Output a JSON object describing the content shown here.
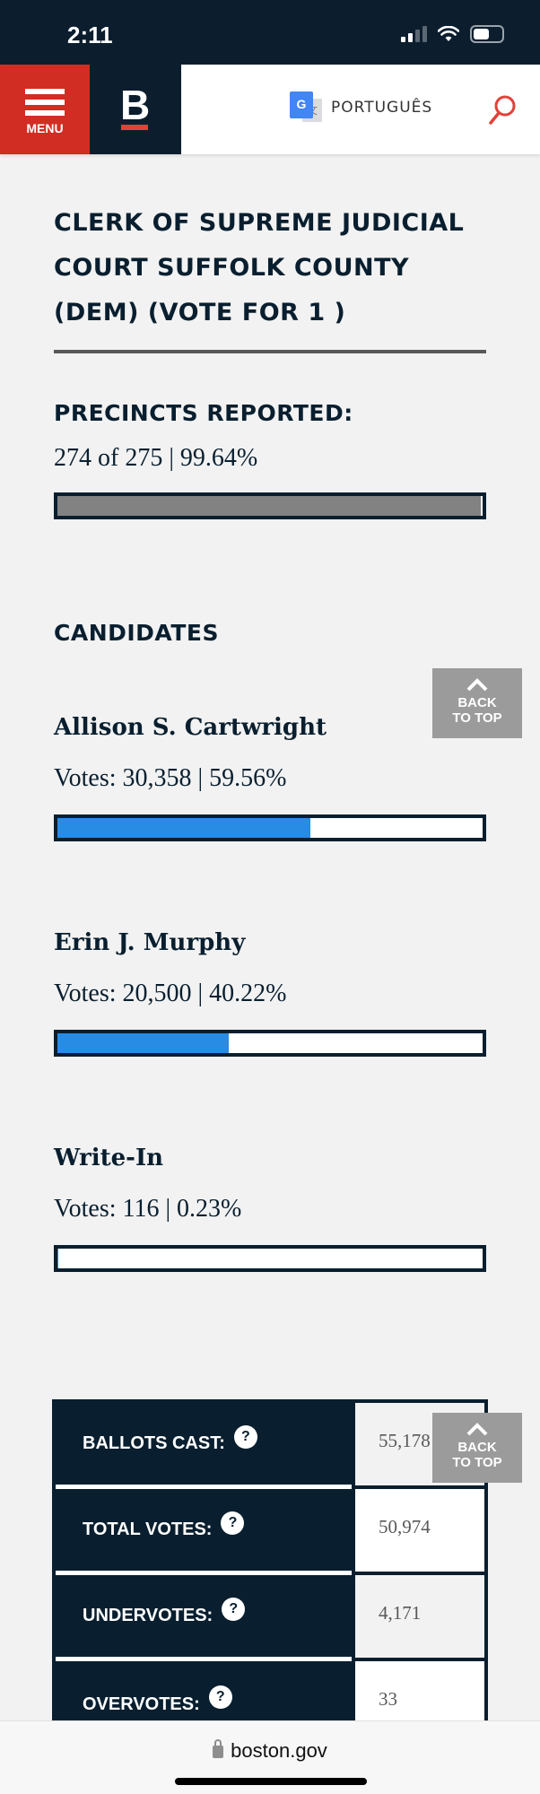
{
  "status_bar": {
    "time": "2:11"
  },
  "header": {
    "menu_label": "MENU",
    "logo_letter": "B",
    "translate_label": "PORTUGUÊS",
    "translate_icon_g": "G",
    "translate_icon_zh": "文"
  },
  "contest": {
    "title": "CLERK OF SUPREME JUDICIAL COURT SUFFOLK COUNTY (DEM) (VOTE FOR 1 )",
    "precincts_label": "PRECINCTS REPORTED:",
    "precincts_value": "274 of 275 | 99.64%",
    "precincts_fraction": 0.9964
  },
  "candidates_label": "CANDIDATES",
  "back_to_top": {
    "line1": "BACK",
    "line2": "TO TOP"
  },
  "candidates": [
    {
      "name": "Allison S. Cartwright",
      "votes_text": "Votes: 30,358 | 59.56%",
      "percent": 59.56
    },
    {
      "name": "Erin J. Murphy",
      "votes_text": "Votes: 20,500 | 40.22%",
      "percent": 40.22
    },
    {
      "name": "Write-In",
      "votes_text": "Votes: 116 | 0.23%",
      "percent": 0.23
    }
  ],
  "stats": [
    {
      "label": "BALLOTS CAST:",
      "value": "55,178"
    },
    {
      "label": "TOTAL VOTES:",
      "value": "50,974"
    },
    {
      "label": "UNDERVOTES:",
      "value": "4,171"
    },
    {
      "label": "OVERVOTES:",
      "value": "33"
    }
  ],
  "help_glyph": "?",
  "browser": {
    "url": "boston.gov"
  },
  "colors": {
    "brand_red": "#d22d23",
    "navy": "#091f2f",
    "bar_blue": "#288be4",
    "precinct_gray": "#828282"
  }
}
